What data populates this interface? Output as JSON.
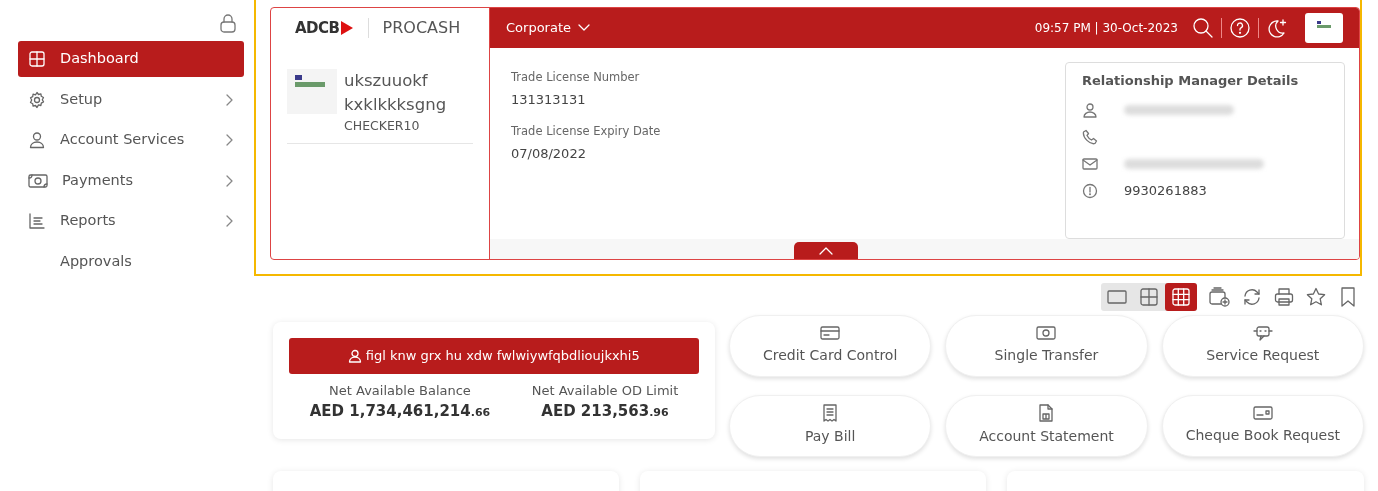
{
  "sidebar": {
    "items": [
      {
        "label": "Dashboard",
        "selected": true,
        "has_submenu": false
      },
      {
        "label": "Setup",
        "selected": false,
        "has_submenu": true
      },
      {
        "label": "Account Services",
        "selected": false,
        "has_submenu": true
      },
      {
        "label": "Payments",
        "selected": false,
        "has_submenu": true
      },
      {
        "label": "Reports",
        "selected": false,
        "has_submenu": true
      },
      {
        "label": "Approvals",
        "selected": false,
        "has_submenu": false
      }
    ]
  },
  "header": {
    "logo": {
      "brand": "ADCB",
      "product": "PROCASH"
    },
    "user": {
      "name_line1": "ukszuuokf",
      "name_line2": "kxklkkksgng",
      "role": "CHECKER10"
    },
    "menu": "Corporate",
    "datetime": "09:57 PM | 30-Oct-2023",
    "details": [
      {
        "label": "Trade License Number",
        "value": "131313131"
      },
      {
        "label": "Trade License Expiry Date",
        "value": "07/08/2022"
      }
    ],
    "relationship_manager": {
      "title": "Relationship Manager Details",
      "number": "9930261883"
    }
  },
  "view_options": [
    {
      "selected": false
    },
    {
      "selected": false
    },
    {
      "selected": true
    }
  ],
  "summary": {
    "account_button": "figl knw grx hu xdw fwlwiywfqbdlioujkxhi5",
    "balances": [
      {
        "label": "Net Available Balance",
        "amount": "AED 1,734,461,214",
        "decimals": ".66"
      },
      {
        "label": "Net Available OD Limit",
        "amount": "AED 213,563",
        "decimals": ".96"
      }
    ]
  },
  "quick_actions": [
    {
      "label": "Credit Card Control"
    },
    {
      "label": "Single Transfer"
    },
    {
      "label": "Service Request"
    },
    {
      "label": "Pay Bill"
    },
    {
      "label": "Account Statement"
    },
    {
      "label": "Cheque Book Request"
    }
  ]
}
